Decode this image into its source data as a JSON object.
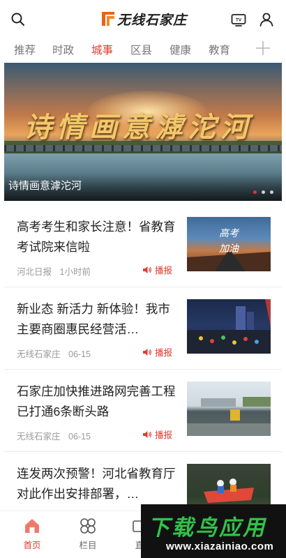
{
  "header": {
    "logo_text": "无线石家庄",
    "brand_color": "#e8631a"
  },
  "tabs": [
    {
      "label": "推荐",
      "active": false
    },
    {
      "label": "时政",
      "active": false
    },
    {
      "label": "城事",
      "active": true
    },
    {
      "label": "区县",
      "active": false
    },
    {
      "label": "健康",
      "active": false
    },
    {
      "label": "教育",
      "active": false
    }
  ],
  "banner": {
    "calligraphy": "诗情画意滹沱河",
    "caption": "诗情画意滹沱河",
    "slide_count": 3,
    "active_slide": 1
  },
  "news": [
    {
      "title": "高考考生和家长注意！省教育考试院来信啦",
      "source": "河北日报",
      "time": "1小时前",
      "broadcast_label": "播报",
      "thumb_text": "高考 加油"
    },
    {
      "title": "新业态 新活力 新体验！我市主要商圈惠民经营活…",
      "source": "无线石家庄",
      "time": "06-15",
      "broadcast_label": "播报",
      "thumb_text": ""
    },
    {
      "title": "石家庄加快推进路网完善工程 已打通6条断头路",
      "source": "无线石家庄",
      "time": "06-15",
      "broadcast_label": "播报",
      "thumb_text": ""
    },
    {
      "title": "连发两次预警！河北省教育厅对此作出安排部署，…",
      "source": "",
      "time": "",
      "broadcast_label": "",
      "thumb_text": ""
    }
  ],
  "bottom_nav": [
    {
      "label": "首页",
      "active": true,
      "icon": "home-icon"
    },
    {
      "label": "栏目",
      "active": false,
      "icon": "columns-icon"
    },
    {
      "label": "直",
      "active": false,
      "icon": "live-icon"
    }
  ],
  "watermark": {
    "big": "下载鸟应用",
    "small": "www.xiazainiao.com"
  },
  "colors": {
    "accent": "#e23b2e",
    "text": "#222222",
    "meta": "#9a9a9a"
  }
}
